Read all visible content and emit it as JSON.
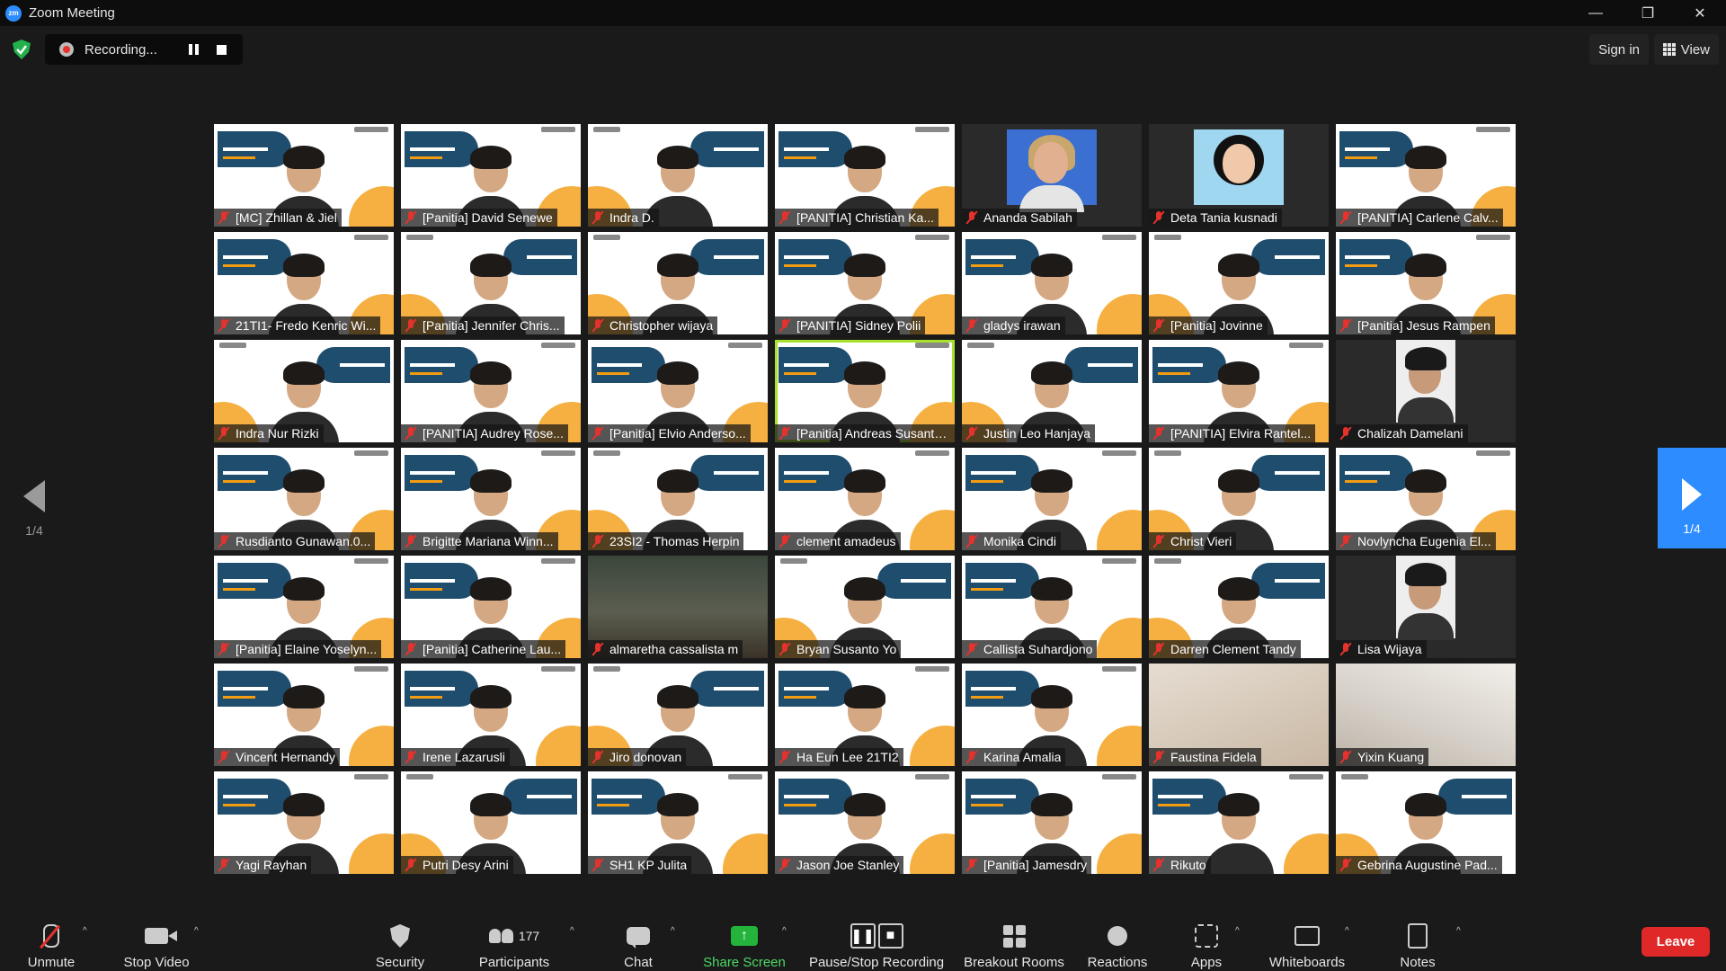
{
  "window": {
    "app_title": "Zoom Meeting",
    "minimize": "—",
    "maximize": "❐",
    "close": "✕"
  },
  "recording": {
    "label": "Recording..."
  },
  "header": {
    "sign_in": "Sign in",
    "view": "View"
  },
  "pagination": {
    "current": "1/4",
    "next_label": "1/4"
  },
  "participants_tiles": [
    {
      "name": "[MC] Zhillan & Jiel",
      "style": "banner"
    },
    {
      "name": "[Panitia] David Senewe",
      "style": "banner"
    },
    {
      "name": "Indra D.",
      "style": "mirror"
    },
    {
      "name": "[PANITIA] Christian Ka...",
      "style": "banner"
    },
    {
      "name": "Ananda Sabilah",
      "style": "photo"
    },
    {
      "name": "Deta Tania kusnadi",
      "style": "photo2"
    },
    {
      "name": "[PANITIA] Carlene Calv...",
      "style": "banner"
    },
    {
      "name": "21TI1- Fredo Kenric Wi...",
      "style": "banner"
    },
    {
      "name": "[Panitia] Jennifer Chris...",
      "style": "mirror"
    },
    {
      "name": "Christopher wijaya",
      "style": "mirror"
    },
    {
      "name": "[PANITIA] Sidney Polii",
      "style": "banner"
    },
    {
      "name": "gladys irawan",
      "style": "banner"
    },
    {
      "name": "[Panitia] Jovinne",
      "style": "mirror"
    },
    {
      "name": "[Panitia] Jesus Rampen",
      "style": "banner"
    },
    {
      "name": "Indra Nur Rizki",
      "style": "mirror"
    },
    {
      "name": "[PANITIA] Audrey Rose...",
      "style": "banner"
    },
    {
      "name": "[Panitia] Elvio Anderso...",
      "style": "banner"
    },
    {
      "name": "[Panitia] Andreas Susanto ...",
      "style": "banner",
      "speaking": true
    },
    {
      "name": "Justin Leo Hanjaya",
      "style": "mirror"
    },
    {
      "name": "[PANITIA] Elvira Rantel...",
      "style": "banner"
    },
    {
      "name": "Chalizah Damelani",
      "style": "portrait"
    },
    {
      "name": "Rusdianto Gunawan.0...",
      "style": "banner"
    },
    {
      "name": "Brigitte Mariana Winn...",
      "style": "banner"
    },
    {
      "name": "23SI2 - Thomas Herpin",
      "style": "mirror"
    },
    {
      "name": "clement amadeus",
      "style": "banner"
    },
    {
      "name": "Monika Cindi",
      "style": "banner"
    },
    {
      "name": "Christ Vieri",
      "style": "mirror"
    },
    {
      "name": "Novlyncha Eugenia El...",
      "style": "banner"
    },
    {
      "name": "[Panitia] Elaine Yoselyn...",
      "style": "banner"
    },
    {
      "name": "[Panitia] Catherine Lau...",
      "style": "banner"
    },
    {
      "name": "almaretha cassalista m",
      "style": "room"
    },
    {
      "name": "Bryan Susanto Yo",
      "style": "mirror"
    },
    {
      "name": "Callista Suhardjono",
      "style": "banner"
    },
    {
      "name": "Darren Clement Tandy",
      "style": "mirror"
    },
    {
      "name": "Lisa Wijaya",
      "style": "portrait"
    },
    {
      "name": "Vincent Hernandy",
      "style": "banner"
    },
    {
      "name": "Irene Lazarusli",
      "style": "banner"
    },
    {
      "name": "Jiro donovan",
      "style": "mirror"
    },
    {
      "name": "Ha Eun Lee 21TI2",
      "style": "banner"
    },
    {
      "name": "Karina Amalia",
      "style": "banner"
    },
    {
      "name": "Faustina Fidela",
      "style": "room2"
    },
    {
      "name": "Yixin Kuang",
      "style": "room3"
    },
    {
      "name": "Yagi Rayhan",
      "style": "banner"
    },
    {
      "name": "Putri Desy Arini",
      "style": "mirror"
    },
    {
      "name": "SH1 KP Julita",
      "style": "banner"
    },
    {
      "name": "Jason Joe Stanley",
      "style": "banner"
    },
    {
      "name": "[Panitia] Jamesdry",
      "style": "banner"
    },
    {
      "name": "Rikuto",
      "style": "banner"
    },
    {
      "name": "Gebrina Augustine Pad...",
      "style": "mirror"
    }
  ],
  "toolbar": {
    "unmute": "Unmute",
    "stop_video": "Stop Video",
    "security": "Security",
    "participants": "Participants",
    "participants_count": "177",
    "chat": "Chat",
    "share_screen": "Share Screen",
    "pause_stop_recording": "Pause/Stop Recording",
    "breakout_rooms": "Breakout Rooms",
    "reactions": "Reactions",
    "apps": "Apps",
    "whiteboards": "Whiteboards",
    "notes": "Notes",
    "leave": "Leave",
    "caret": "^"
  },
  "colors": {
    "accent": "#2D8CFF",
    "leave": "#E02828",
    "share": "#24B33B",
    "muted": "#E5322D",
    "speaking_border": "#A6E22E"
  }
}
